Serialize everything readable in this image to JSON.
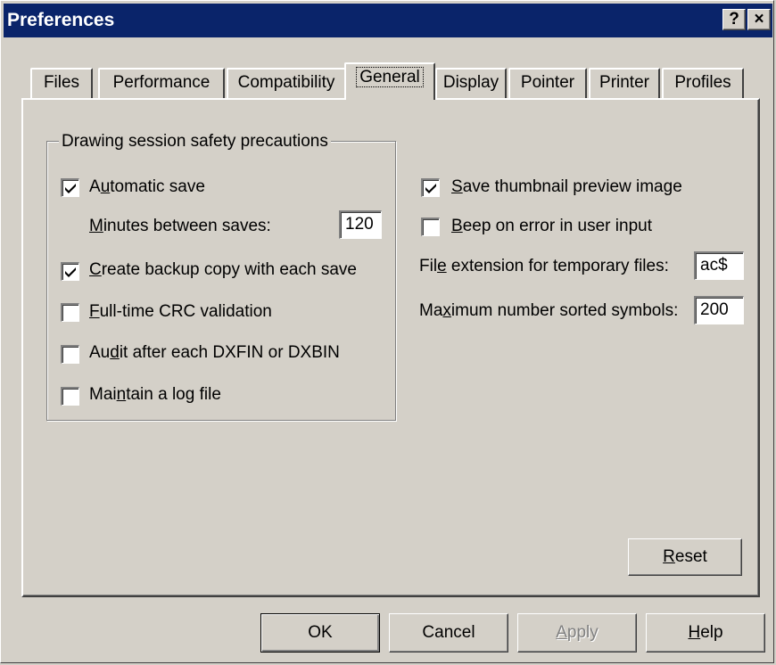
{
  "window": {
    "title": "Preferences",
    "help_button": "?",
    "close_button": "×"
  },
  "tabs": [
    {
      "label": "Files"
    },
    {
      "label": "Performance"
    },
    {
      "label": "Compatibility"
    },
    {
      "label": "General",
      "active": true
    },
    {
      "label": "Display"
    },
    {
      "label": "Pointer"
    },
    {
      "label": "Printer"
    },
    {
      "label": "Profiles"
    }
  ],
  "group": {
    "legend": "Drawing session safety precautions",
    "automatic_save": {
      "label_pre": "A",
      "label_u": "u",
      "label_post": "tomatic save",
      "checked": true
    },
    "minutes": {
      "label_u": "M",
      "label_post": "inutes between saves:",
      "value": "120"
    },
    "backup": {
      "label_u": "C",
      "label_post": "reate backup copy with each save",
      "checked": true
    },
    "crc": {
      "label_u": "F",
      "label_post": "ull-time CRC validation",
      "checked": false
    },
    "audit": {
      "label_pre": "Au",
      "label_u": "d",
      "label_post": "it after each DXFIN or DXBIN",
      "checked": false
    },
    "log": {
      "label_pre": "Mai",
      "label_u": "n",
      "label_post": "tain a log file",
      "checked": false
    }
  },
  "right": {
    "thumbnail": {
      "label_u": "S",
      "label_post": "ave thumbnail preview image",
      "checked": true
    },
    "beep": {
      "label_u": "B",
      "label_post": "eep on error in user input",
      "checked": false
    },
    "temp_ext": {
      "label_pre": "Fil",
      "label_u": "e",
      "label_post": " extension for temporary files:",
      "value": "ac$"
    },
    "max_symbols": {
      "label_pre": "Ma",
      "label_u": "x",
      "label_post": "imum number sorted symbols:",
      "value": "200"
    }
  },
  "buttons": {
    "reset": {
      "label_u": "R",
      "label_post": "eset"
    },
    "ok": "OK",
    "cancel": "Cancel",
    "apply": {
      "label_u": "A",
      "label_post": "pply"
    },
    "help": {
      "label_u": "H",
      "label_post": "elp"
    }
  }
}
